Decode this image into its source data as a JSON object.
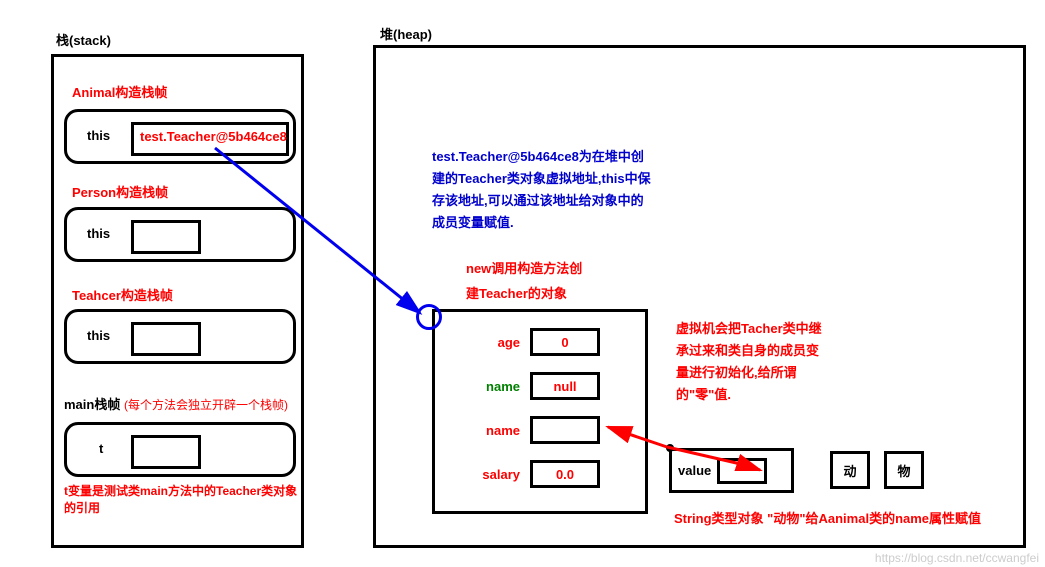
{
  "stack_title": "栈(stack)",
  "heap_title": "堆(heap)",
  "frames": {
    "animal_title": "Animal构造栈帧",
    "person_title": "Person构造栈帧",
    "teacher_title": "Teahcer构造栈帧",
    "main_title": "main栈帧",
    "this_label": "this",
    "t_label": "t",
    "animal_this_value": "test.Teacher@5b464ce8"
  },
  "notes": {
    "main_note": "(每个方法会独立开辟一个栈帧)",
    "t_note": "t变量是测试类main方法中的Teacher类对象的引用",
    "heap_explain": "test.Teacher@5b464ce8为在堆中创建的Teacher类对象虚拟地址,this中保存该地址,可以通过该地址给对象中的成员变量赋值.",
    "new_note_l1": "new调用构造方法创",
    "new_note_l2": "建Teacher的对象",
    "init_note_l1": "虚拟机会把Tacher类中继",
    "init_note_l2": "承过来和类自身的成员变",
    "init_note_l3": "量进行初始化,给所谓",
    "init_note_l4": "的\"零\"值.",
    "string_note": "String类型对象 \"动物\"给Aanimal类的name属性赋值"
  },
  "object": {
    "fields": {
      "age_label": "age",
      "age_value": "0",
      "name1_label": "name",
      "name1_value": "null",
      "name2_label": "name",
      "name2_value": "",
      "salary_label": "salary",
      "salary_value": "0.0"
    }
  },
  "string_obj": {
    "value_label": "value",
    "chars": {
      "c1": "动",
      "c2": "物"
    }
  },
  "watermark": "https://blog.csdn.net/ccwangfei"
}
